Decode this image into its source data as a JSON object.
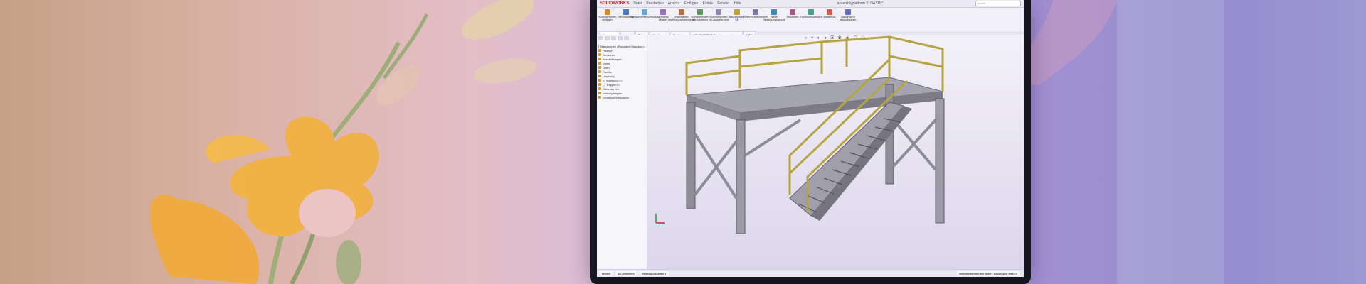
{
  "app": {
    "brand": "SOLIDWORKS",
    "menu": [
      "Datei",
      "Bearbeiten",
      "Ansicht",
      "Einfügen",
      "Extras",
      "Fenster",
      "Hilfe"
    ],
    "document_title": "assemblyplatform.SLDASM *",
    "search_placeholder": "Suche"
  },
  "ribbon": {
    "buttons": [
      {
        "label": "Komponenten einfügen",
        "color": "#d88b2b"
      },
      {
        "label": "Verknüpfung",
        "color": "#4a78c2"
      },
      {
        "label": "Komponentenvorschau",
        "color": "#6aa6d8"
      },
      {
        "label": "Lineares Muster",
        "color": "#9a6fc2"
      },
      {
        "label": "Intelligente Verbindungselemente",
        "color": "#c46a3b"
      },
      {
        "label": "Komponenten verschieben",
        "color": "#5a9a5a"
      },
      {
        "label": "Komponenten ein-/ausblenden",
        "color": "#8a8ab0"
      },
      {
        "label": "Baugruppen-KE",
        "color": "#c2a03a"
      },
      {
        "label": "Referenzgeometrie",
        "color": "#7a7aa8"
      },
      {
        "label": "Neue Bewegungsstudie",
        "color": "#3a8ac2"
      },
      {
        "label": "Stückliste",
        "color": "#aa5a8a"
      },
      {
        "label": "Explosionsansicht",
        "color": "#4aa08a"
      },
      {
        "label": "Instant3D",
        "color": "#d25a4a"
      },
      {
        "label": "Baugruppe aktualisieren",
        "color": "#6a6ac2"
      }
    ]
  },
  "command_tabs": [
    "Baugruppe",
    "Layout",
    "Skizze",
    "Markierung",
    "Evaluieren",
    "SOLIDWORKS Zusatzanwendungen",
    "MBD"
  ],
  "tree": {
    "items": [
      "Baugruppe1 (Standard<Standard>)",
      "Historie",
      "Sensoren",
      "Beschriftungen",
      "Vorne",
      "Oben",
      "Rechts",
      "Ursprung",
      "(f) Stahlbau<1>",
      "(-) Treppe<1>",
      "Geländer<1>",
      "Verknüpfungen",
      "Schweißkonstruktion"
    ]
  },
  "heads_up": "⌕ ⌖ ◐ ◑ ▣ ◉ ◈ ▢ ◇",
  "status": {
    "tabs": [
      "Modell",
      "3D-Ansichten",
      "Bewegungsstudie 1"
    ],
    "right": "Unterbestimmt  Bearbeiten: Baugruppe  MMGS"
  },
  "colors": {
    "steel": "#8d8c97",
    "rail": "#b6a443",
    "accent": "#d21f2f"
  }
}
